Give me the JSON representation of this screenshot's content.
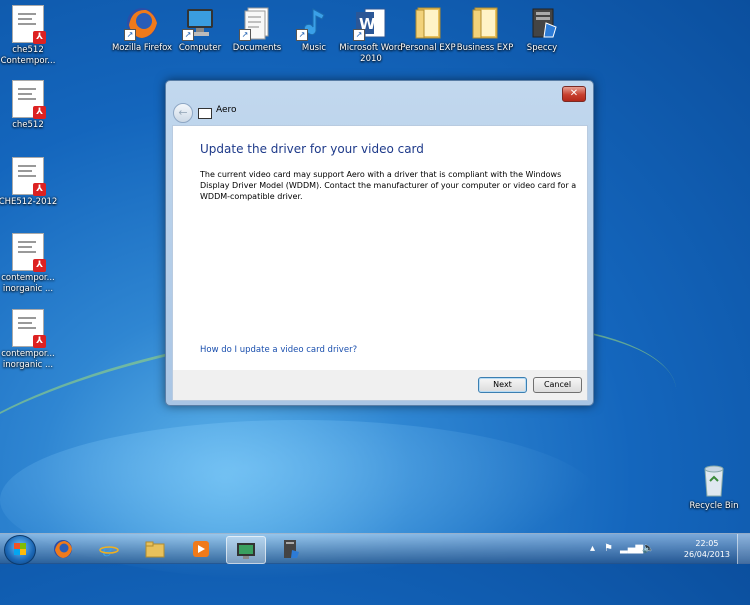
{
  "desktop": {
    "icons_left": [
      {
        "label": "che512 Contempor...",
        "type": "pdf"
      },
      {
        "label": "che512",
        "type": "pdf"
      },
      {
        "label": "CHE512-2012",
        "type": "pdf"
      },
      {
        "label": "contempor... inorganic ...",
        "type": "pdf"
      },
      {
        "label": "contempor... inorganic ...",
        "type": "pdf"
      }
    ],
    "icons_top": [
      {
        "label": "Mozilla Firefox",
        "icon": "firefox-icon"
      },
      {
        "label": "Computer",
        "icon": "computer-icon"
      },
      {
        "label": "Documents",
        "icon": "documents-icon"
      },
      {
        "label": "Music",
        "icon": "music-icon"
      },
      {
        "label": "Microsoft Word 2010",
        "icon": "word-icon"
      },
      {
        "label": "Personal EXP",
        "icon": "folder-icon"
      },
      {
        "label": "Business EXP",
        "icon": "folder-icon"
      },
      {
        "label": "Speccy",
        "icon": "speccy-icon"
      }
    ],
    "recycle_bin": "Recycle Bin"
  },
  "dialog": {
    "title": "Aero",
    "close_label": "✕",
    "back_label": "←",
    "heading": "Update the driver for your video card",
    "body": "The current video card may support Aero with a driver that is compliant with the Windows Display Driver Model (WDDM).  Contact the manufacturer of your computer or video card for a WDDM-compatible driver.",
    "link": "How do I update a video card driver?",
    "next_label": "Next",
    "cancel_label": "Cancel"
  },
  "taskbar": {
    "pinned": [
      "firefox-icon",
      "internet-explorer-icon",
      "explorer-icon",
      "media-player-icon",
      "display-icon",
      "speccy-icon"
    ],
    "active_index": 4,
    "clock_time": "22:05",
    "clock_date": "26/04/2013"
  },
  "colors": {
    "dialog_heading": "#1e3a8a",
    "link": "#1a4fae",
    "close_button": "#c7402f"
  }
}
